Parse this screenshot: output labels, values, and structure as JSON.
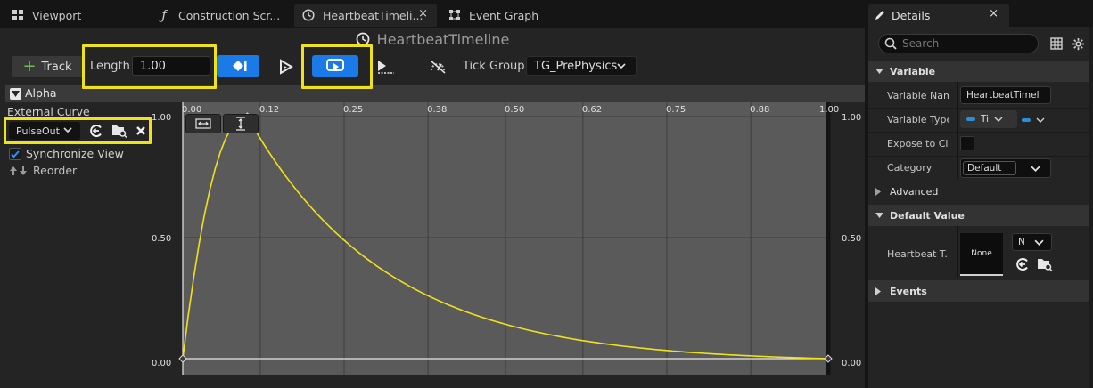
{
  "tabs": [
    {
      "label": "Viewport",
      "icon": "grid-icon"
    },
    {
      "label": "Construction Scr...",
      "icon": "function-icon"
    },
    {
      "label": "HeartbeatTimeli...",
      "icon": "clock-icon",
      "close": "×"
    },
    {
      "label": "Event Graph",
      "icon": "graph-icon"
    }
  ],
  "editor": {
    "title": "HeartbeatTimeline",
    "track_button": "Track",
    "length_label": "Length",
    "length_value": "1.00",
    "tick_group_label": "Tick Group",
    "tick_group_value": "TG_PrePhysics"
  },
  "track": {
    "name": "Alpha",
    "external_curve_label": "External Curve",
    "curve_value": "PulseOut",
    "sync_view_label": "Synchronize View",
    "sync_view_checked": true,
    "reorder_label": "Reorder"
  },
  "graph": {
    "x_ticks": [
      "0.00",
      "0.12",
      "0.25",
      "0.38",
      "0.50",
      "0.62",
      "0.75",
      "0.88",
      "1.00"
    ],
    "y_ticks_left": [
      "1.00",
      "0.50",
      "0.00"
    ],
    "y_ticks_right": [
      "1.00",
      "0.50",
      "0.00"
    ],
    "curve_color": "#f0e21a",
    "keys": [
      {
        "time": 0.0,
        "value": 0.0
      },
      {
        "time": 0.1,
        "value": 1.0
      },
      {
        "time": 1.0,
        "value": 0.0
      }
    ]
  },
  "details": {
    "tab_label": "Details",
    "close": "×",
    "search_placeholder": "Search",
    "sections": {
      "variable": "Variable",
      "advanced": "Advanced",
      "default_value": "Default Value",
      "events": "Events"
    },
    "props": {
      "variable_name_label": "Variable Nam",
      "variable_name_value": "HeartbeatTimel",
      "variable_type_label": "Variable Type",
      "variable_type_value": "Ti",
      "expose_label": "Expose to Cin",
      "category_label": "Category",
      "category_value": "Default",
      "heartbeat_label": "Heartbeat T...",
      "heartbeat_thumb": "None",
      "heartbeat_select": "N"
    }
  },
  "colors": {
    "accent_blue": "#1a7be8",
    "highlight_yellow": "#f0e21a",
    "track_green": "#6bc04b"
  }
}
